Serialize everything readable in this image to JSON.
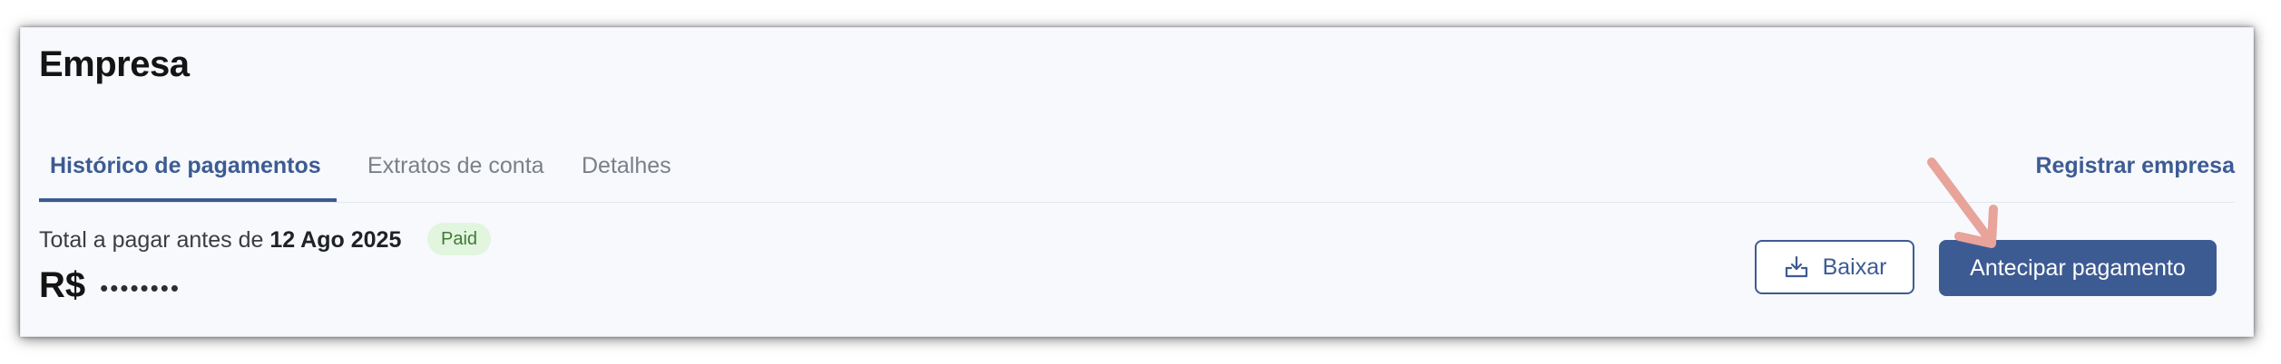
{
  "company": {
    "title": "Empresa"
  },
  "tabs": [
    {
      "label": "Histórico de pagamentos",
      "active": true
    },
    {
      "label": "Extratos de conta",
      "active": false
    },
    {
      "label": "Detalhes",
      "active": false
    }
  ],
  "header_action": {
    "register_label": "Registrar empresa"
  },
  "summary": {
    "total_prefix": "Total a pagar antes de",
    "due_date": "12 Ago 2025",
    "status_badge": "Paid",
    "currency": "R$",
    "masked_amount": "••••••••"
  },
  "actions": {
    "download_label": "Baixar",
    "download_icon": "download-tray-icon",
    "anticipate_label": "Antecipar pagamento"
  },
  "annotation": {
    "arrow_icon": "pointer-arrow-icon",
    "arrow_color": "#e8a39a"
  },
  "colors": {
    "accent": "#3d5b93",
    "badge_bg": "#e2f5df",
    "badge_text": "#3f7a36"
  }
}
